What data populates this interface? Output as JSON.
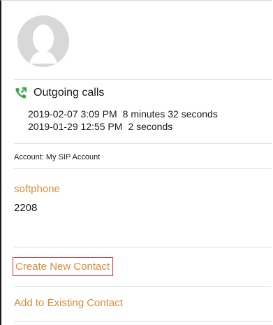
{
  "contact": {
    "avatar_icon": "person-placeholder-icon"
  },
  "calls": {
    "icon": "outgoing-call-icon",
    "title": "Outgoing calls",
    "entries": [
      {
        "datetime": "2019-02-07 3:09 PM",
        "duration": "8 minutes 32 seconds"
      },
      {
        "datetime": "2019-01-29 12:55 PM",
        "duration": "2 seconds"
      }
    ]
  },
  "account": {
    "label": "Account: My SIP Account"
  },
  "phone": {
    "type": "softphone",
    "number": "2208"
  },
  "actions": {
    "create_label": "Create New Contact",
    "add_existing_label": "Add to Existing Contact"
  },
  "colors": {
    "accent": "#e08a3a",
    "call_icon": "#3aa845",
    "highlight_border": "#d23a3a"
  }
}
